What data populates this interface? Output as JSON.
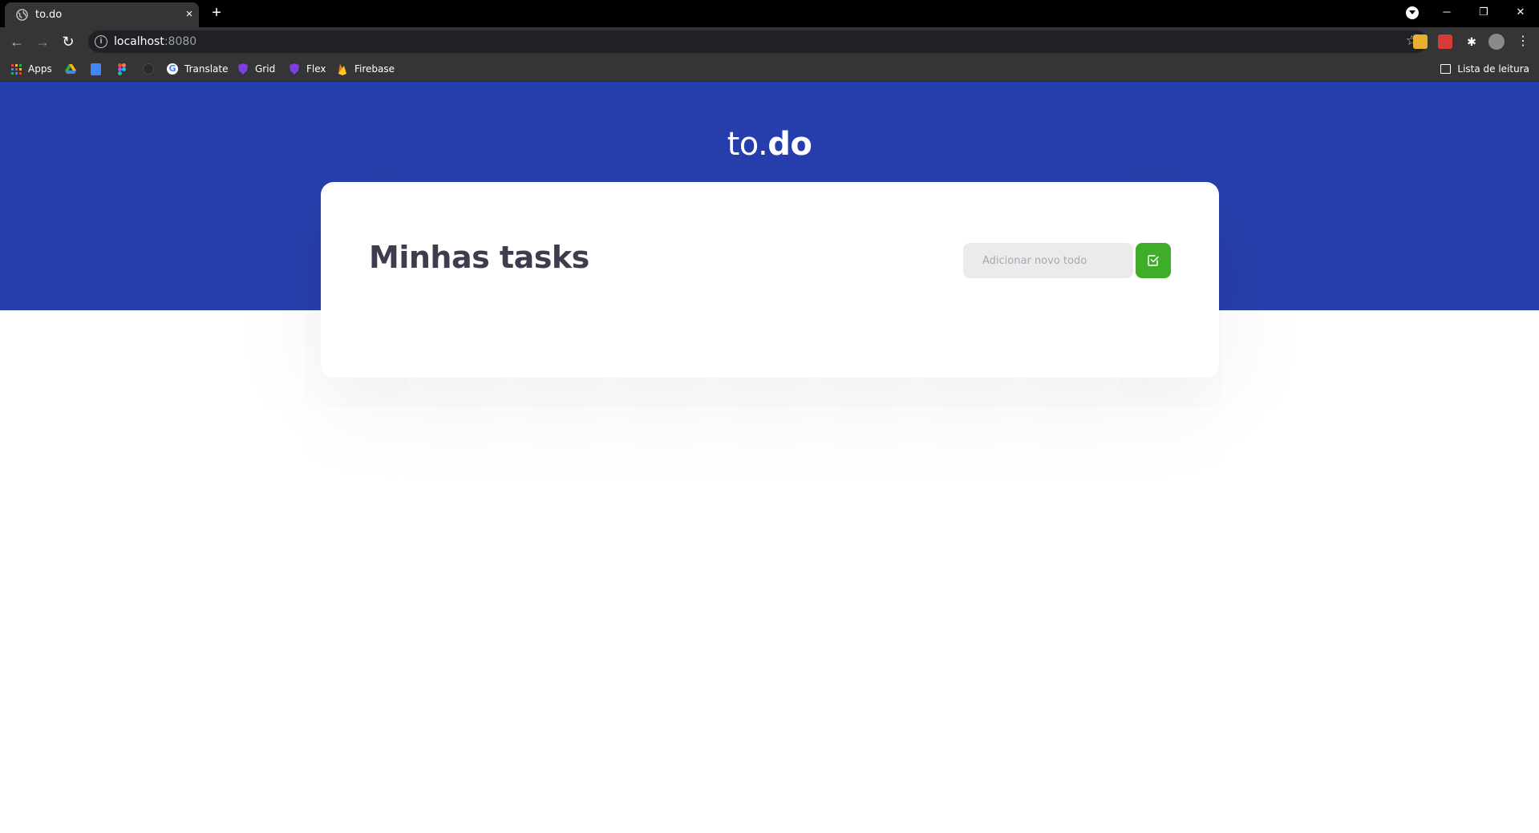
{
  "browser": {
    "tab": {
      "title": "to.do",
      "close": "×"
    },
    "new_tab": "+",
    "window_controls": {
      "minimize": "─",
      "restore": "❐",
      "close": "✕"
    },
    "nav": {
      "back": "←",
      "forward": "→",
      "reload": "↻"
    },
    "omnibox": {
      "info": "i",
      "host": "localhost",
      "port": ":8080",
      "star": "☆"
    },
    "bookmarks": [
      {
        "label": "Apps",
        "icon": "apps-grid-icon"
      },
      {
        "label": "",
        "icon": "google-drive-icon",
        "color": "#34a853"
      },
      {
        "label": "",
        "icon": "google-docs-icon",
        "color": "#4285f4"
      },
      {
        "label": "",
        "icon": "figma-icon",
        "color": "#f24e1e"
      },
      {
        "label": "",
        "icon": "dark-circle-icon",
        "color": "#3a3a3a"
      },
      {
        "label": "Translate",
        "icon": "google-icon",
        "color": "#ffffff"
      },
      {
        "label": "Grid",
        "icon": "shield-icon",
        "color": "#7b3fe4"
      },
      {
        "label": "Flex",
        "icon": "shield-icon",
        "color": "#7b3fe4"
      },
      {
        "label": "Firebase",
        "icon": "firebase-icon",
        "color": "#ffca28"
      }
    ],
    "reading_list": "Lista de leitura"
  },
  "app": {
    "logo": {
      "thin": "to.",
      "bold": "do"
    },
    "card": {
      "title": "Minhas tasks",
      "input_placeholder": "Adicionar novo todo",
      "add_button_icon": "check-square-icon"
    }
  },
  "colors": {
    "hero": "#273fad",
    "add_button": "#3fad27",
    "title": "#3d3d4d",
    "input_bg": "#ebebeb"
  }
}
